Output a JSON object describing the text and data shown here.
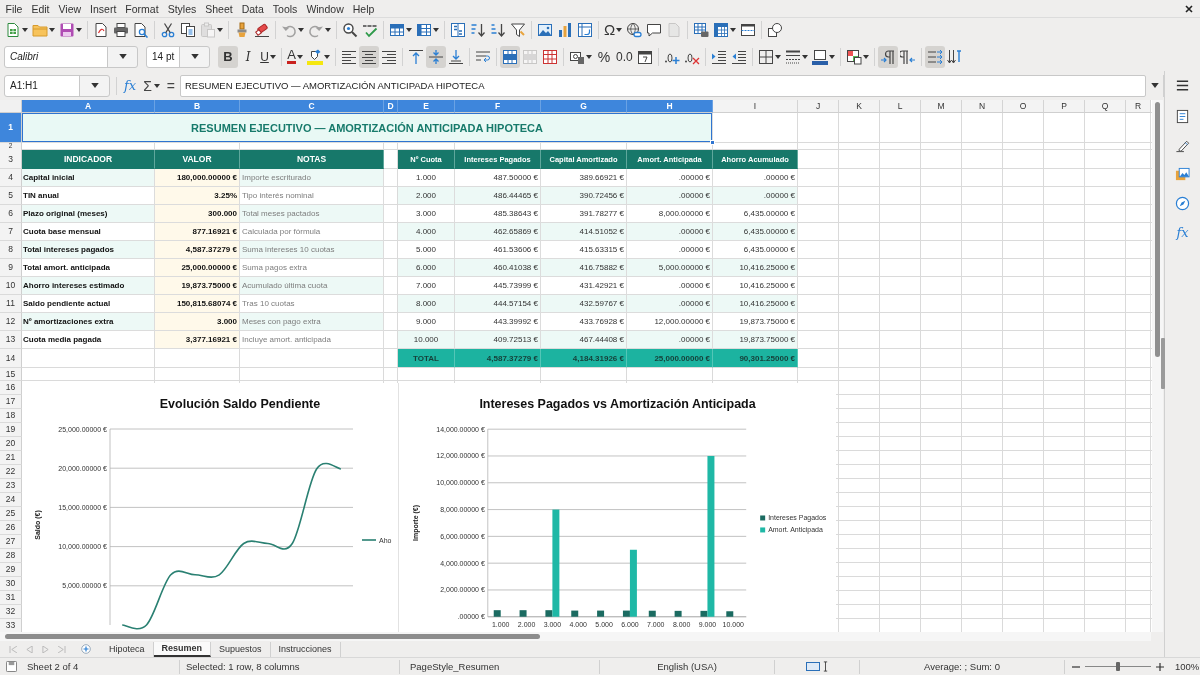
{
  "menu_bar": [
    "File",
    "Edit",
    "View",
    "Insert",
    "Format",
    "Styles",
    "Sheet",
    "Data",
    "Tools",
    "Window",
    "Help"
  ],
  "standard_toolbar": [
    [
      {
        "kind": "new",
        "dropdown": true,
        "disabled": false
      },
      {
        "kind": "open",
        "dropdown": true,
        "disabled": false
      },
      {
        "kind": "save",
        "dropdown": true,
        "disabled": false
      }
    ],
    [
      {
        "kind": "export_pdf",
        "dropdown": false,
        "disabled": false
      },
      {
        "kind": "print",
        "dropdown": false,
        "disabled": false
      },
      {
        "kind": "print_preview",
        "dropdown": false,
        "disabled": false
      }
    ],
    [
      {
        "kind": "cut",
        "dropdown": false,
        "disabled": false
      },
      {
        "kind": "copy",
        "dropdown": false,
        "disabled": false
      },
      {
        "kind": "paste",
        "dropdown": true,
        "disabled": true
      }
    ],
    [
      {
        "kind": "clone_formatting",
        "dropdown": false,
        "disabled": false
      },
      {
        "kind": "clear_formatting",
        "dropdown": false,
        "disabled": false
      }
    ],
    [
      {
        "kind": "undo",
        "dropdown": true,
        "disabled": true
      },
      {
        "kind": "redo",
        "dropdown": true,
        "disabled": true
      }
    ],
    [
      {
        "kind": "find_replace",
        "dropdown": false,
        "disabled": false
      },
      {
        "kind": "spelling",
        "dropdown": false,
        "disabled": false
      }
    ],
    [
      {
        "kind": "row",
        "dropdown": true,
        "disabled": false
      },
      {
        "kind": "column",
        "dropdown": true,
        "disabled": false
      }
    ],
    [
      {
        "kind": "sort",
        "dropdown": false,
        "disabled": false
      },
      {
        "kind": "sort_ascending",
        "dropdown": false,
        "disabled": false
      },
      {
        "kind": "sort_descending",
        "dropdown": false,
        "disabled": false
      },
      {
        "kind": "autofilter",
        "dropdown": false,
        "disabled": false
      }
    ],
    [
      {
        "kind": "image",
        "dropdown": false,
        "disabled": false
      },
      {
        "kind": "chart",
        "dropdown": false,
        "disabled": false
      },
      {
        "kind": "pivot_table",
        "dropdown": false,
        "disabled": false
      }
    ],
    [
      {
        "kind": "special_character",
        "label": "Ω",
        "dropdown": true,
        "disabled": false
      },
      {
        "kind": "hyperlink",
        "dropdown": false,
        "disabled": false
      },
      {
        "kind": "comment",
        "dropdown": false,
        "disabled": false
      },
      {
        "kind": "header_footer",
        "dropdown": false,
        "disabled": true
      }
    ],
    [
      {
        "kind": "print_area",
        "dropdown": false,
        "disabled": false
      },
      {
        "kind": "freeze",
        "dropdown": true,
        "disabled": false
      },
      {
        "kind": "split_window",
        "dropdown": false,
        "disabled": false
      }
    ],
    [
      {
        "kind": "draw_functions",
        "dropdown": false,
        "disabled": false
      }
    ]
  ],
  "formatting_toolbar": {
    "font_name": "Calibri",
    "font_size": "14 pt",
    "groups": [
      [
        {
          "kind": "bold",
          "label": "B",
          "active": true,
          "disabled": false,
          "dropdown": false
        },
        {
          "kind": "italic",
          "label": "I",
          "active": false,
          "disabled": false,
          "dropdown": false
        },
        {
          "kind": "underline",
          "label": "U",
          "active": false,
          "disabled": false,
          "dropdown": true
        }
      ],
      [
        {
          "kind": "font_color",
          "label": "A",
          "active": false,
          "disabled": false,
          "dropdown": true
        },
        {
          "kind": "highlight",
          "active": false,
          "disabled": false,
          "dropdown": true
        }
      ],
      [
        {
          "kind": "align_left",
          "active": false,
          "disabled": false,
          "dropdown": false
        },
        {
          "kind": "align_center",
          "active": true,
          "disabled": false,
          "dropdown": false
        },
        {
          "kind": "align_right",
          "active": false,
          "disabled": false,
          "dropdown": false
        }
      ],
      [
        {
          "kind": "align_top",
          "active": false,
          "disabled": false,
          "dropdown": false
        },
        {
          "kind": "align_middle",
          "active": true,
          "disabled": false,
          "dropdown": false
        },
        {
          "kind": "align_bottom",
          "active": false,
          "disabled": false,
          "dropdown": false
        }
      ],
      [
        {
          "kind": "wrap_text",
          "active": false,
          "disabled": false,
          "dropdown": false
        }
      ],
      [
        {
          "kind": "merge_center",
          "active": true,
          "disabled": false,
          "dropdown": false
        },
        {
          "kind": "merge",
          "active": false,
          "disabled": true,
          "dropdown": false
        },
        {
          "kind": "unmerge",
          "active": false,
          "disabled": false,
          "dropdown": false
        }
      ],
      [
        {
          "kind": "number_format",
          "active": false,
          "disabled": false,
          "dropdown": true
        },
        {
          "kind": "percent",
          "label": "%",
          "active": false,
          "disabled": false,
          "dropdown": false
        },
        {
          "kind": "number",
          "label": "0.0",
          "active": false,
          "disabled": false,
          "dropdown": false
        },
        {
          "kind": "date",
          "active": false,
          "disabled": false,
          "dropdown": false
        }
      ],
      [
        {
          "kind": "add_decimal",
          "active": false,
          "disabled": false,
          "dropdown": false
        },
        {
          "kind": "delete_decimal",
          "active": false,
          "disabled": false,
          "dropdown": false
        }
      ],
      [
        {
          "kind": "indent_increase",
          "active": false,
          "disabled": false,
          "dropdown": false
        },
        {
          "kind": "indent_decrease",
          "active": false,
          "disabled": false,
          "dropdown": false
        }
      ],
      [
        {
          "kind": "borders",
          "active": false,
          "disabled": false,
          "dropdown": true
        },
        {
          "kind": "border_style",
          "active": false,
          "disabled": false,
          "dropdown": true
        },
        {
          "kind": "border_color",
          "active": false,
          "disabled": false,
          "dropdown": true
        }
      ],
      [
        {
          "kind": "conditional",
          "active": false,
          "disabled": false,
          "dropdown": true
        }
      ],
      [
        {
          "kind": "paragraph_ltr",
          "active": true,
          "disabled": false,
          "dropdown": false
        },
        {
          "kind": "paragraph_rtl",
          "active": false,
          "disabled": false,
          "dropdown": false
        }
      ],
      [
        {
          "kind": "text_horizontal",
          "active": true,
          "disabled": false,
          "dropdown": false
        },
        {
          "kind": "text_vertical",
          "active": false,
          "disabled": false,
          "dropdown": false
        }
      ]
    ]
  },
  "formula_bar": {
    "name_box": "A1:H1",
    "function_wizard": "fx",
    "sum": "Σ",
    "equals": "=",
    "content": "RESUMEN EJECUTIVO — AMORTIZACIÓN ANTICIPADA HIPOTECA"
  },
  "sidebar": {
    "functions": "fx"
  },
  "sheet": {
    "columns": [
      {
        "label": "A",
        "selected": true
      },
      {
        "label": "B",
        "selected": true
      },
      {
        "label": "C",
        "selected": true
      },
      {
        "label": "D",
        "selected": true
      },
      {
        "label": "E",
        "selected": true
      },
      {
        "label": "F",
        "selected": true
      },
      {
        "label": "G",
        "selected": true
      },
      {
        "label": "H",
        "selected": true
      },
      {
        "label": "I",
        "selected": false
      },
      {
        "label": "J",
        "selected": false
      },
      {
        "label": "K",
        "selected": false
      },
      {
        "label": "L",
        "selected": false
      },
      {
        "label": "M",
        "selected": false
      },
      {
        "label": "N",
        "selected": false
      },
      {
        "label": "O",
        "selected": false
      },
      {
        "label": "P",
        "selected": false
      },
      {
        "label": "Q",
        "selected": false
      },
      {
        "label": "R",
        "selected": false
      }
    ],
    "rows": [
      {
        "label": "1",
        "selected": true
      },
      {
        "label": "2",
        "selected": false
      },
      {
        "label": "3",
        "selected": false
      },
      {
        "label": "4",
        "selected": false
      },
      {
        "label": "5",
        "selected": false
      },
      {
        "label": "6",
        "selected": false
      },
      {
        "label": "7",
        "selected": false
      },
      {
        "label": "8",
        "selected": false
      },
      {
        "label": "9",
        "selected": false
      },
      {
        "label": "10",
        "selected": false
      },
      {
        "label": "11",
        "selected": false
      },
      {
        "label": "12",
        "selected": false
      },
      {
        "label": "13",
        "selected": false
      },
      {
        "label": "14",
        "selected": false
      },
      {
        "label": "15",
        "selected": false
      },
      {
        "label": "16",
        "selected": false
      },
      {
        "label": "17",
        "selected": false
      },
      {
        "label": "18",
        "selected": false
      },
      {
        "label": "19",
        "selected": false
      },
      {
        "label": "20",
        "selected": false
      },
      {
        "label": "21",
        "selected": false
      },
      {
        "label": "22",
        "selected": false
      },
      {
        "label": "23",
        "selected": false
      },
      {
        "label": "24",
        "selected": false
      },
      {
        "label": "25",
        "selected": false
      },
      {
        "label": "26",
        "selected": false
      },
      {
        "label": "27",
        "selected": false
      },
      {
        "label": "28",
        "selected": false
      },
      {
        "label": "29",
        "selected": false
      },
      {
        "label": "30",
        "selected": false
      },
      {
        "label": "31",
        "selected": false
      },
      {
        "label": "32",
        "selected": false
      },
      {
        "label": "33",
        "selected": false
      }
    ],
    "title": "RESUMEN EJECUTIVO — AMORTIZACIÓN ANTICIPADA HIPOTECA",
    "summary": {
      "headers": [
        "INDICADOR",
        "VALOR",
        "NOTAS"
      ],
      "rows": [
        {
          "indicator": "Capital inicial",
          "value": "180,000.00000 €",
          "note": "Importe escriturado",
          "shaded": true
        },
        {
          "indicator": "TIN anual",
          "value": "3.25%",
          "note": "Tipo interés nominal",
          "shaded": false
        },
        {
          "indicator": "Plazo original (meses)",
          "value": "300.000",
          "note": "Total meses pactados",
          "shaded": true
        },
        {
          "indicator": "Cuota base mensual",
          "value": "877.16921 €",
          "note": "Calculada por fórmula",
          "shaded": false
        },
        {
          "indicator": "Total intereses pagados",
          "value": "4,587.37279 €",
          "note": "Suma intereses 10 cuotas",
          "shaded": true
        },
        {
          "indicator": "Total amort. anticipada",
          "value": "25,000.00000 €",
          "note": "Suma pagos extra",
          "shaded": false
        },
        {
          "indicator": "Ahorro intereses estimado",
          "value": "19,873.75000 €",
          "note": "Acumulado última cuota",
          "shaded": true
        },
        {
          "indicator": "Saldo pendiente actual",
          "value": "150,815.68074 €",
          "note": "Tras 10 cuotas",
          "shaded": false
        },
        {
          "indicator": "Nº amortizaciones extra",
          "value": "3.000",
          "note": "Meses con pago extra",
          "shaded": true
        },
        {
          "indicator": "Cuota media pagada",
          "value": "3,377.16921 €",
          "note": "Incluye amort. anticipada",
          "shaded": false
        }
      ]
    },
    "schedule": {
      "headers": [
        "Nº Cuota",
        "Intereses Pagados",
        "Capital Amortizado",
        "Amort. Anticipada",
        "Ahorro Acumulado"
      ],
      "rows": [
        {
          "cells": [
            "1.000",
            "487.50000 €",
            "389.66921 €",
            ".00000 €",
            ".00000 €"
          ],
          "shaded": false
        },
        {
          "cells": [
            "2.000",
            "486.44465 €",
            "390.72456 €",
            ".00000 €",
            ".00000 €"
          ],
          "shaded": true
        },
        {
          "cells": [
            "3.000",
            "485.38643 €",
            "391.78277 €",
            "8,000.00000 €",
            "6,435.00000 €"
          ],
          "shaded": false
        },
        {
          "cells": [
            "4.000",
            "462.65869 €",
            "414.51052 €",
            ".00000 €",
            "6,435.00000 €"
          ],
          "shaded": true
        },
        {
          "cells": [
            "5.000",
            "461.53606 €",
            "415.63315 €",
            ".00000 €",
            "6,435.00000 €"
          ],
          "shaded": false
        },
        {
          "cells": [
            "6.000",
            "460.41038 €",
            "416.75882 €",
            "5,000.00000 €",
            "10,416.25000 €"
          ],
          "shaded": true
        },
        {
          "cells": [
            "7.000",
            "445.73999 €",
            "431.42921 €",
            ".00000 €",
            "10,416.25000 €"
          ],
          "shaded": false
        },
        {
          "cells": [
            "8.000",
            "444.57154 €",
            "432.59767 €",
            ".00000 €",
            "10,416.25000 €"
          ],
          "shaded": true
        },
        {
          "cells": [
            "9.000",
            "443.39992 €",
            "433.76928 €",
            "12,000.00000 €",
            "19,873.75000 €"
          ],
          "shaded": false
        },
        {
          "cells": [
            "10.000",
            "409.72513 €",
            "467.44408 €",
            ".00000 €",
            "19,873.75000 €"
          ],
          "shaded": true
        }
      ],
      "total": [
        "TOTAL",
        "4,587.37279 €",
        "4,184.31926 €",
        "25,000.00000 €",
        "90,301.25000 €"
      ]
    },
    "charts": [
      {
        "chart_data": {
          "type": "line",
          "title": "Evolución Saldo Pendiente",
          "ylabel": "Saldo (€)",
          "series": [
            {
              "name": "Aho",
              "color": "#2a8072",
              "values": [
                0,
                0,
                6400,
                6400,
                6400,
                10400,
                10400,
                10400,
                19900,
                19900
              ]
            }
          ],
          "ylim": [
            0,
            25000
          ],
          "yticks": [
            {
              "value": 5000,
              "label": "5,000.00000 €"
            },
            {
              "value": 10000,
              "label": "10,000.00000 €"
            },
            {
              "value": 15000,
              "label": "15,000.00000 €"
            },
            {
              "value": 20000,
              "label": "20,000.00000 €"
            },
            {
              "value": 25000,
              "label": "25,000.00000 €"
            }
          ],
          "grid": true,
          "legend": "right"
        }
      },
      {
        "chart_data": {
          "type": "bar",
          "title": "Intereses Pagados vs Amortización Anticipada",
          "ylabel": "Importe (€)",
          "categories": [
            "1.000",
            "2.000",
            "3.000",
            "4.000",
            "5.000",
            "6.000",
            "7.000",
            "8.000",
            "9.000",
            "10.000"
          ],
          "series": [
            {
              "name": "Intereses Pagados",
              "color": "#1b6b61",
              "values": [
                490,
                490,
                490,
                460,
                460,
                460,
                450,
                440,
                440,
                410
              ]
            },
            {
              "name": "Amort. Anticipada",
              "color": "#1fb8a6",
              "values": [
                0,
                0,
                8000,
                0,
                0,
                5000,
                0,
                0,
                12000,
                0
              ]
            }
          ],
          "ylim": [
            0,
            14000
          ],
          "yticks": [
            {
              "value": 0,
              "label": ".00000 €"
            },
            {
              "value": 2000,
              "label": "2,000.00000 €"
            },
            {
              "value": 4000,
              "label": "4,000.00000 €"
            },
            {
              "value": 6000,
              "label": "6,000.00000 €"
            },
            {
              "value": 8000,
              "label": "8,000.00000 €"
            },
            {
              "value": 10000,
              "label": "10,000.00000 €"
            },
            {
              "value": 12000,
              "label": "12,000.00000 €"
            },
            {
              "value": 14000,
              "label": "14,000.00000 €"
            }
          ],
          "grid": true,
          "legend": "right"
        }
      }
    ]
  },
  "sheet_tabs": [
    {
      "label": "Hipoteca",
      "selected": false
    },
    {
      "label": "Resumen",
      "selected": true
    },
    {
      "label": "Supuestos",
      "selected": false
    },
    {
      "label": "Instrucciones",
      "selected": false
    }
  ],
  "status_bar": {
    "sheet": "Sheet 2 of 4",
    "selection": "Selected: 1 row, 8 columns",
    "page_style": "PageStyle_Resumen",
    "language": "English (USA)",
    "summary": "Average: ; Sum: 0",
    "zoom_slider": {
      "level": 0.5
    },
    "zoom": "100%"
  }
}
